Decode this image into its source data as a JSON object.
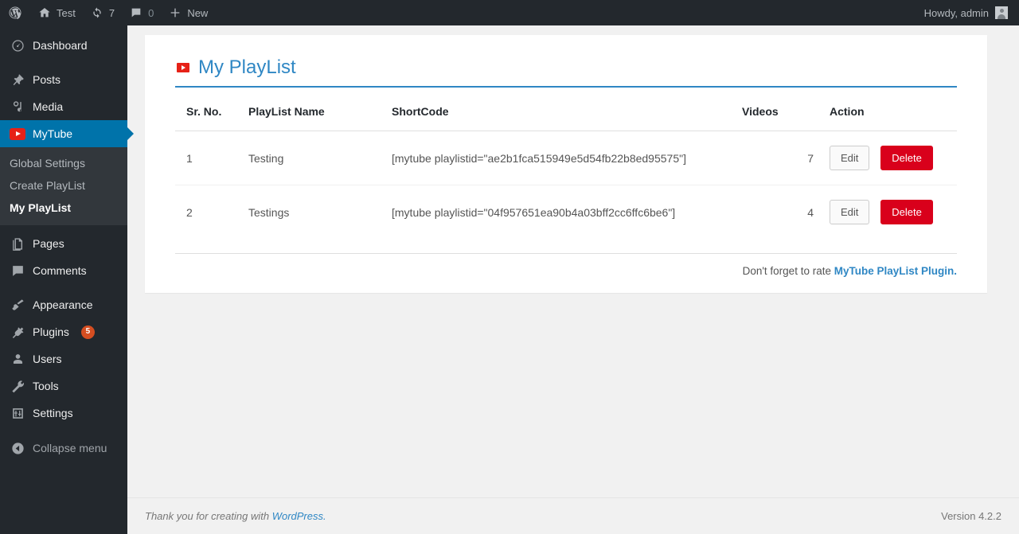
{
  "adminbar": {
    "wp_logo": "wordpress-logo-icon",
    "site_name": "Test",
    "updates_count": "7",
    "comments_count": "0",
    "new_label": "New",
    "howdy": "Howdy, admin"
  },
  "sidebar": {
    "items": [
      {
        "label": "Dashboard",
        "icon": "dashboard-icon"
      },
      {
        "label": "Posts",
        "icon": "pin-icon"
      },
      {
        "label": "Media",
        "icon": "media-icon"
      },
      {
        "label": "MyTube",
        "icon": "youtube-icon"
      },
      {
        "label": "Pages",
        "icon": "pages-icon"
      },
      {
        "label": "Comments",
        "icon": "comment-icon"
      },
      {
        "label": "Appearance",
        "icon": "brush-icon"
      },
      {
        "label": "Plugins",
        "icon": "plug-icon",
        "badge": "5"
      },
      {
        "label": "Users",
        "icon": "user-icon"
      },
      {
        "label": "Tools",
        "icon": "wrench-icon"
      },
      {
        "label": "Settings",
        "icon": "sliders-icon"
      }
    ],
    "submenu": [
      {
        "label": "Global Settings"
      },
      {
        "label": "Create PlayList"
      },
      {
        "label": "My PlayList"
      }
    ],
    "collapse": {
      "label": "Collapse menu",
      "icon": "collapse-icon"
    }
  },
  "page": {
    "title": "My PlayList",
    "title_icon": "youtube-icon",
    "accent_color": "#2f87c4",
    "youtube_red": "#e62117"
  },
  "table": {
    "headers": [
      "Sr. No.",
      "PlayList Name",
      "ShortCode",
      "Videos",
      "Action"
    ],
    "rows": [
      {
        "sr": "1",
        "name": "Testing",
        "shortcode": "[mytube playlistid=\"ae2b1fca515949e5d54fb22b8ed95575\"]",
        "videos": "7",
        "edit": "Edit",
        "delete": "Delete"
      },
      {
        "sr": "2",
        "name": "Testings",
        "shortcode": "[mytube playlistid=\"04f957651ea90b4a03bff2cc6ffc6be6\"]",
        "videos": "4",
        "edit": "Edit",
        "delete": "Delete"
      }
    ]
  },
  "rate": {
    "text": "Don't forget to rate ",
    "link": "MyTube PlayList Plugin."
  },
  "footer": {
    "thanks_prefix": "Thank you for creating with ",
    "wordpress_link": "WordPress.",
    "version": "Version 4.2.2"
  }
}
